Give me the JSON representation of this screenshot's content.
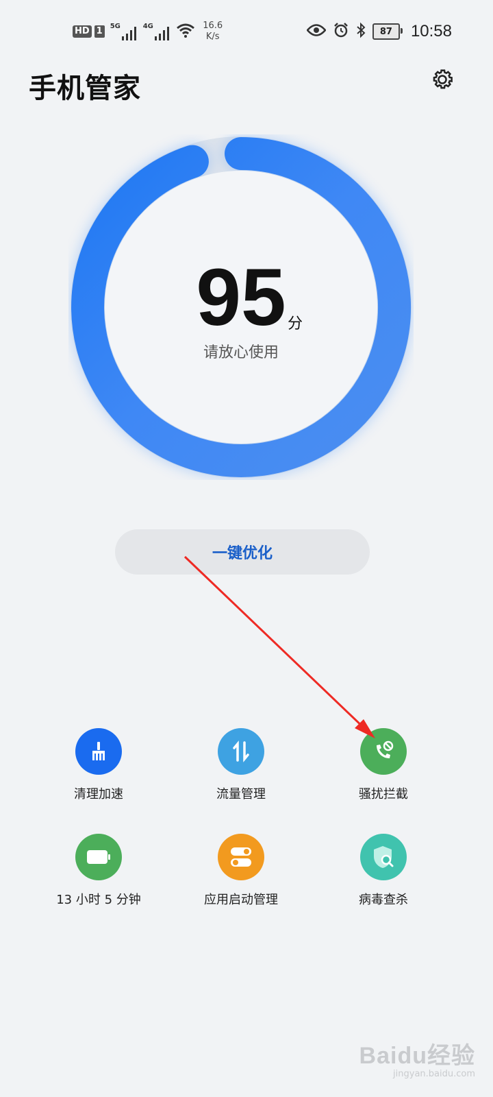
{
  "status_bar": {
    "hd": "HD",
    "sim": "1",
    "net1": "5G",
    "net2": "4G",
    "speed_value": "16.6",
    "speed_unit": "K/s",
    "battery": "87",
    "time": "10:58"
  },
  "header": {
    "title": "手机管家"
  },
  "score": {
    "value": "95",
    "unit": "分",
    "status": "请放心使用"
  },
  "optimize_button": "一键优化",
  "tools": [
    {
      "label": "清理加速",
      "icon": "broom-icon",
      "color": "#1a6bef"
    },
    {
      "label": "流量管理",
      "icon": "data-transfer-icon",
      "color": "#3ea2e2"
    },
    {
      "label": "骚扰拦截",
      "icon": "call-block-icon",
      "color": "#4cae5a"
    },
    {
      "label": "13 小时 5 分钟",
      "icon": "battery-icon",
      "color": "#4cae5a"
    },
    {
      "label": "应用启动管理",
      "icon": "app-launch-toggle-icon",
      "color": "#f29a1f"
    },
    {
      "label": "病毒查杀",
      "icon": "shield-search-icon",
      "color": "#40c3ae"
    }
  ],
  "watermark": {
    "logo": "Baidu经验",
    "url": "jingyan.baidu.com"
  }
}
